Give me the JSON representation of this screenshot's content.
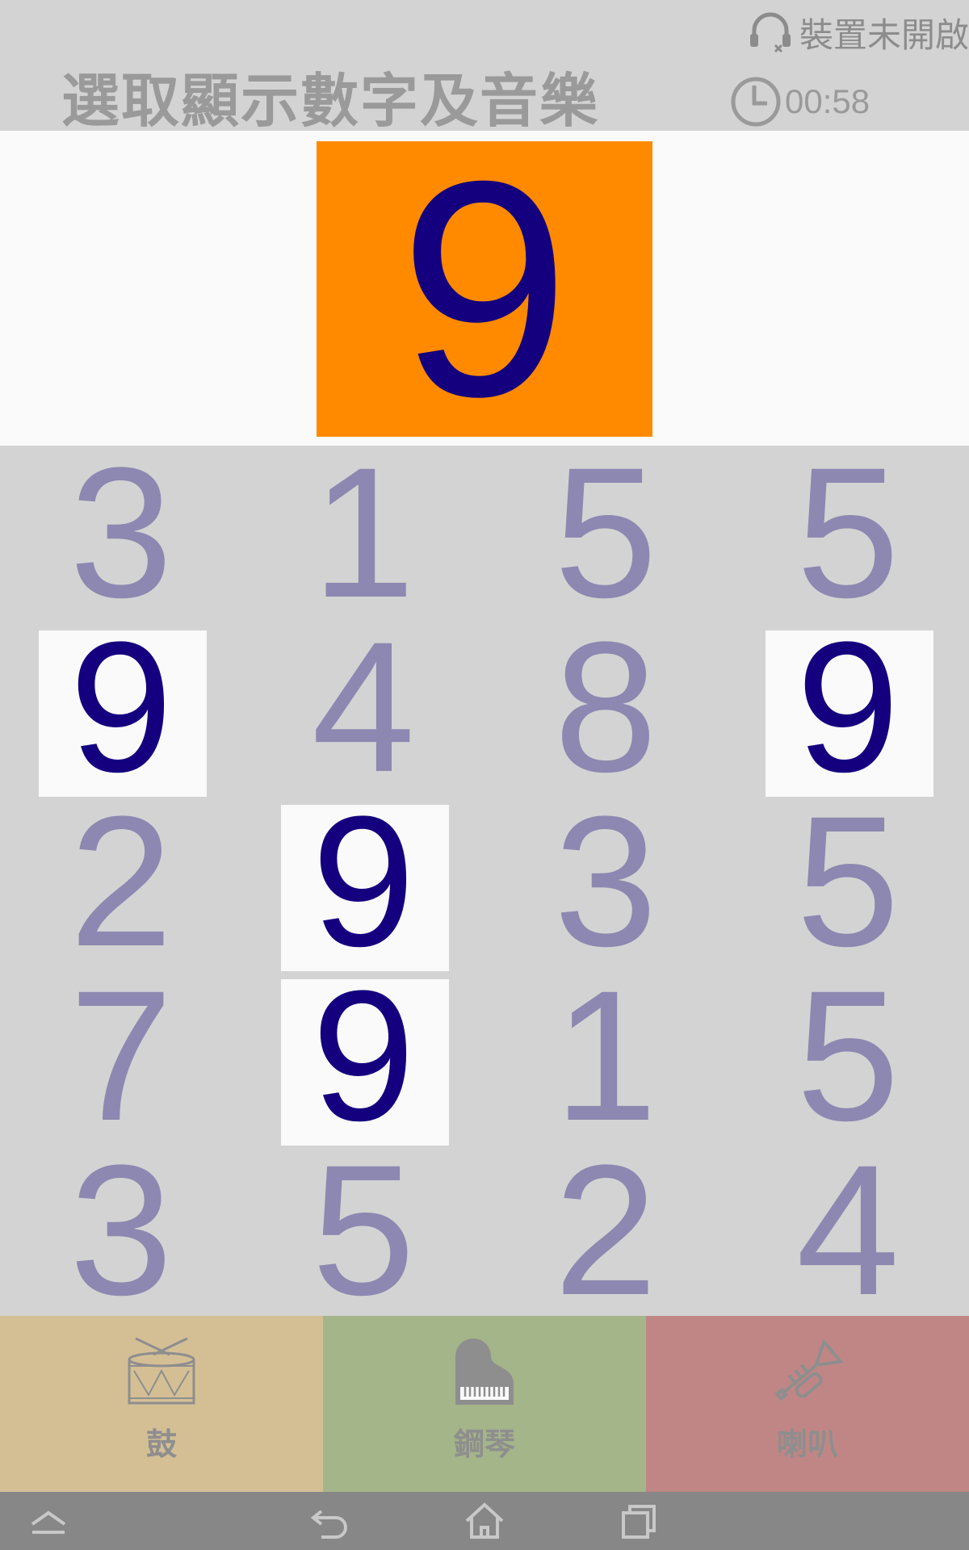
{
  "header": {
    "device_status": "裝置未開啟",
    "title": "選取顯示數字及音樂",
    "timer": "00:58"
  },
  "target": {
    "digit": "9",
    "color": "#ff8a00"
  },
  "grid": [
    [
      "3",
      "1",
      "5",
      "5"
    ],
    [
      "9",
      "4",
      "8",
      "9"
    ],
    [
      "2",
      "9",
      "3",
      "5"
    ],
    [
      "7",
      "9",
      "1",
      "5"
    ],
    [
      "3",
      "5",
      "2",
      "4"
    ]
  ],
  "highlighted": [
    [
      1,
      0
    ],
    [
      1,
      3
    ],
    [
      2,
      1
    ],
    [
      3,
      1
    ]
  ],
  "instruments": [
    {
      "label": "鼓",
      "icon": "drum-icon",
      "color": "#d4bf95"
    },
    {
      "label": "鋼琴",
      "icon": "piano-icon",
      "color": "#a4b589"
    },
    {
      "label": "喇叭",
      "icon": "trumpet-icon",
      "color": "#c08686"
    }
  ],
  "navbar": {
    "icons": [
      "collapse-icon",
      "back-icon",
      "home-icon",
      "recents-icon"
    ]
  }
}
